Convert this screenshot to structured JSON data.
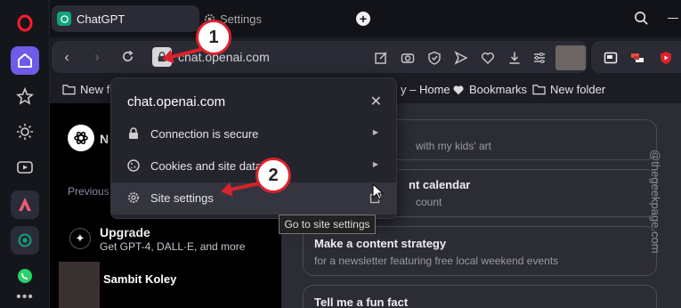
{
  "browser": {
    "tabs": [
      {
        "title": "ChatGPT"
      },
      {
        "title": "Settings"
      }
    ],
    "address_bar": {
      "url": "chat.openai.com"
    },
    "bookmarks": [
      {
        "label": "New fo"
      },
      {
        "label": "y – Home"
      },
      {
        "label": "Bookmarks"
      },
      {
        "label": "New folder"
      }
    ]
  },
  "site_popup": {
    "domain": "chat.openai.com",
    "rows": [
      {
        "label": "Connection is secure"
      },
      {
        "label": "Cookies and site data"
      },
      {
        "label": "Site settings"
      }
    ],
    "tooltip": "Go to site settings"
  },
  "chatgpt_sidebar": {
    "new_chat_label": "N",
    "previous_label": "Previous",
    "upgrade": {
      "title": "Upgrade",
      "subtitle": "Get GPT-4, DALL·E, and more"
    },
    "user_name": "Sambit Koley"
  },
  "suggestions": [
    {
      "title": "",
      "subtitle": "with my kids' art"
    },
    {
      "title": "nt calendar",
      "subtitle": "count"
    },
    {
      "title": "Make a content strategy",
      "subtitle": "for a newsletter featuring free local weekend events"
    },
    {
      "title": "Tell me a fun fact",
      "subtitle": ""
    }
  ],
  "annotations": {
    "marker_1": "1",
    "marker_2": "2"
  },
  "watermark": "@thegeekpage.com",
  "colors": {
    "accent": "#6c5ce7",
    "marker_red": "#d9232d",
    "chatgpt_green": "#10a37f"
  }
}
